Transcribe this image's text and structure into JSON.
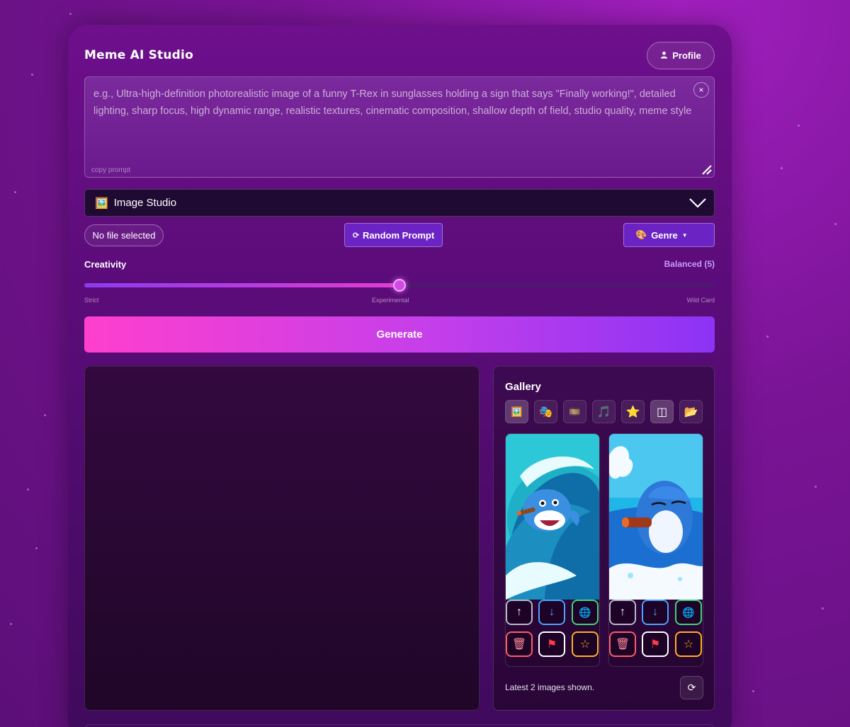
{
  "app": {
    "title": "Meme AI Studio"
  },
  "header": {
    "profile_label": "Profile",
    "profile_icon": "user-icon"
  },
  "prompt": {
    "placeholder": "e.g., Ultra-high-definition photorealistic image of a funny T-Rex in sunglasses holding a sign that says \"Finally working!\", detailed lighting, sharp focus, high dynamic range, realistic textures, cinematic composition, shallow depth of field, studio quality, meme style",
    "copy_label": "copy prompt",
    "clear_icon": "×"
  },
  "mode_select": {
    "icon": "🖼️",
    "value": "Image Studio"
  },
  "controls": {
    "file_label": "No file selected",
    "random_prompt_label": "Random Prompt",
    "random_icon": "⟳",
    "genre_label": "Genre",
    "genre_icon": "🎨",
    "genre_caret": "▼"
  },
  "creativity": {
    "label": "Creativity",
    "value_label": "Balanced (5)",
    "value": 5,
    "min": 0,
    "max": 10,
    "ticks": [
      "Strict",
      "Experimental",
      "Wild Card"
    ]
  },
  "generate": {
    "label": "Generate"
  },
  "gallery": {
    "title": "Gallery",
    "filters": [
      {
        "name": "filter-images",
        "glyph": "🖼️",
        "active": true
      },
      {
        "name": "filter-memes",
        "glyph": "🎭",
        "active": false
      },
      {
        "name": "filter-videos",
        "glyph": "🎞️",
        "active": false
      },
      {
        "name": "filter-music",
        "glyph": "🎵",
        "active": false
      },
      {
        "name": "filter-favorites",
        "glyph": "⭐",
        "active": false
      },
      {
        "name": "filter-layout",
        "glyph": "◫",
        "active": true
      },
      {
        "name": "filter-folders",
        "glyph": "📂",
        "active": false
      }
    ],
    "actions_row1": [
      {
        "name": "upscale",
        "glyph": "↑",
        "color": "#b8b8c8"
      },
      {
        "name": "download",
        "glyph": "↓",
        "color": "#4aa3ff"
      },
      {
        "name": "publish",
        "glyph": "🌐",
        "color": "#3ed37a"
      }
    ],
    "actions_row2": [
      {
        "name": "delete",
        "glyph": "🗑",
        "color": "#ff5a6a"
      },
      {
        "name": "report",
        "glyph": "⚑",
        "color": "#ffffff"
      },
      {
        "name": "favorite",
        "glyph": "☆",
        "color": "#ffb020"
      }
    ],
    "footer": "Latest 2 images shown.",
    "refresh_icon": "⟳"
  },
  "colors": {
    "accent": "#6c23c4",
    "generate_start": "#ff3fce",
    "generate_end": "#8c33f5",
    "slider_value": "#c69bff"
  }
}
